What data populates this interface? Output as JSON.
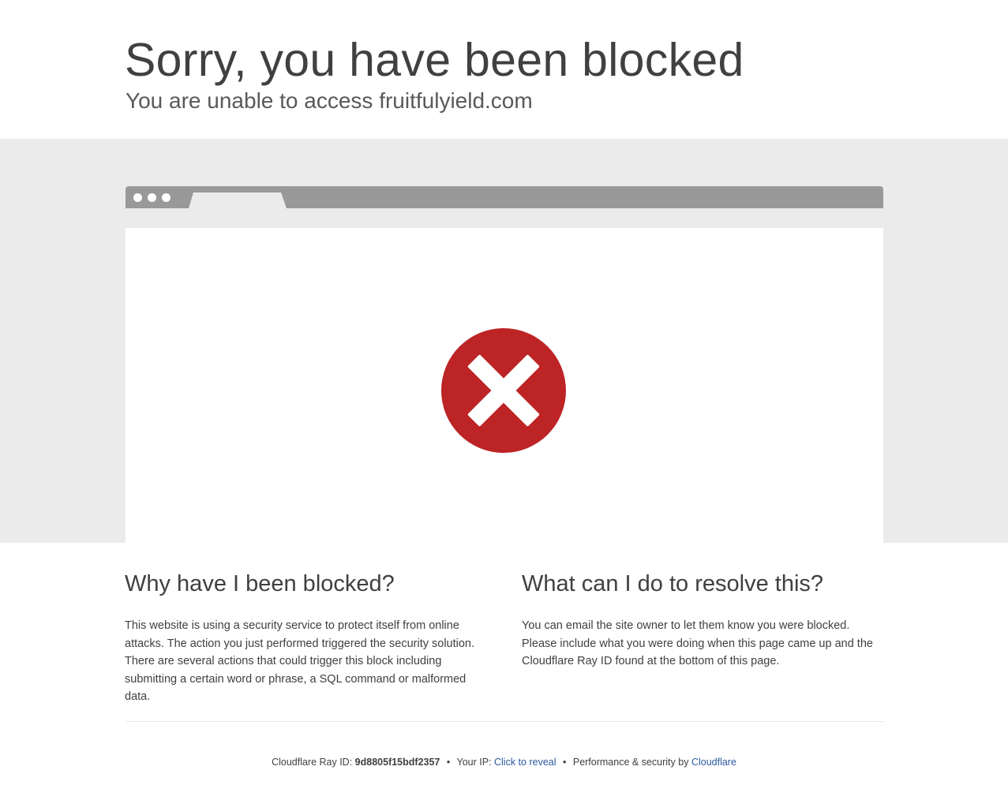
{
  "header": {
    "title": "Sorry, you have been blocked",
    "subtitle": "You are unable to access fruitfulyield.com"
  },
  "illustration": {
    "icon": "error-x-icon",
    "icon_color": "#bd2426",
    "bar_color": "#999999",
    "band_color": "#ebebeb"
  },
  "why": {
    "heading": "Why have I been blocked?",
    "body": "This website is using a security service to protect itself from online attacks. The action you just performed triggered the security solution. There are several actions that could trigger this block including submitting a certain word or phrase, a SQL command or malformed data."
  },
  "resolve": {
    "heading": "What can I do to resolve this?",
    "body": "You can email the site owner to let them know you were blocked. Please include what you were doing when this page came up and the Cloudflare Ray ID found at the bottom of this page."
  },
  "footer": {
    "ray_label": "Cloudflare Ray ID:",
    "ray_id": "9d8805f15bdf2357",
    "separator": "•",
    "ip_label": "Your IP:",
    "ip_link": "Click to reveal",
    "perf_label": "Performance & security by",
    "cloudflare_link": "Cloudflare",
    "link_color": "#2c5aa0"
  }
}
